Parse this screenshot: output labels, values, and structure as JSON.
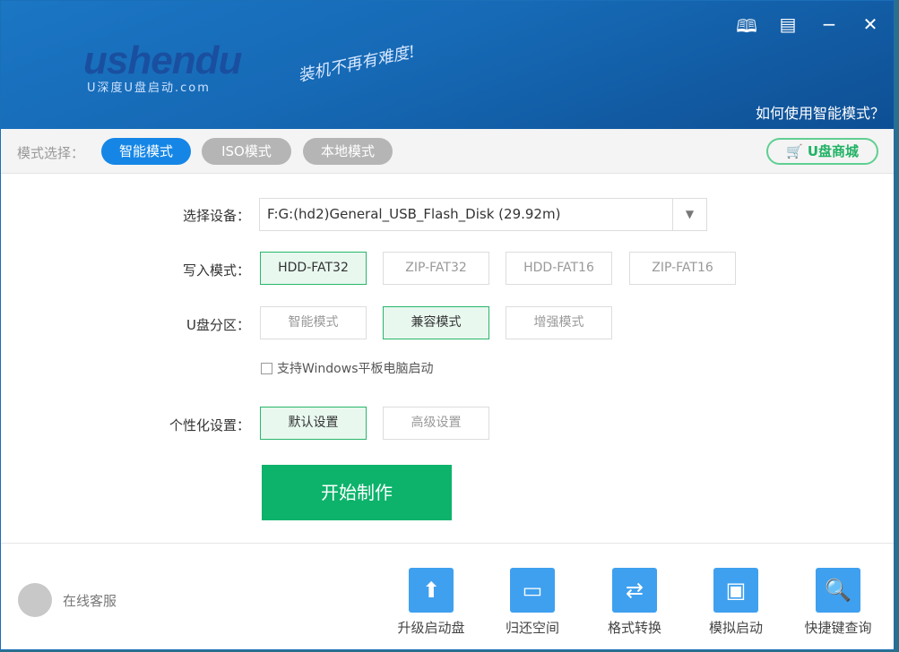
{
  "header": {
    "logo_text": "ushendu",
    "logo_sub": "U深度U盘启动.com",
    "slogan": "装机不再有难度!",
    "help_link": "如何使用智能模式？",
    "icons": [
      "book-icon",
      "message-icon",
      "minimize-icon",
      "close-icon"
    ]
  },
  "modebar": {
    "label": "模式选择：",
    "modes": [
      "智能模式",
      "ISO模式",
      "本地模式"
    ],
    "selected": "智能模式",
    "shop": "U盘商城"
  },
  "form": {
    "device_label": "选择设备：",
    "device_value": "F:G:(hd2)General_USB_Flash_Disk (29.92m)",
    "write_label": "写入模式：",
    "write_options": [
      "HDD-FAT32",
      "ZIP-FAT32",
      "HDD-FAT16",
      "ZIP-FAT16"
    ],
    "write_selected": "HDD-FAT32",
    "partition_label": "U盘分区：",
    "partition_options": [
      "智能模式",
      "兼容模式",
      "增强模式"
    ],
    "partition_selected": "兼容模式",
    "tablet_checkbox": "支持Windows平板电脑启动",
    "tablet_checked": false,
    "custom_label": "个性化设置：",
    "custom_options": [
      "默认设置",
      "高级设置"
    ],
    "custom_selected": "默认设置",
    "start_button": "开始制作"
  },
  "footer": {
    "service": "在线客服",
    "tools": [
      "升级启动盘",
      "归还空间",
      "格式转换",
      "模拟启动",
      "快捷键查询"
    ]
  },
  "colors": {
    "accent": "#1586e6",
    "green": "#0db36b",
    "tool_icon": "#3fa0ef"
  }
}
